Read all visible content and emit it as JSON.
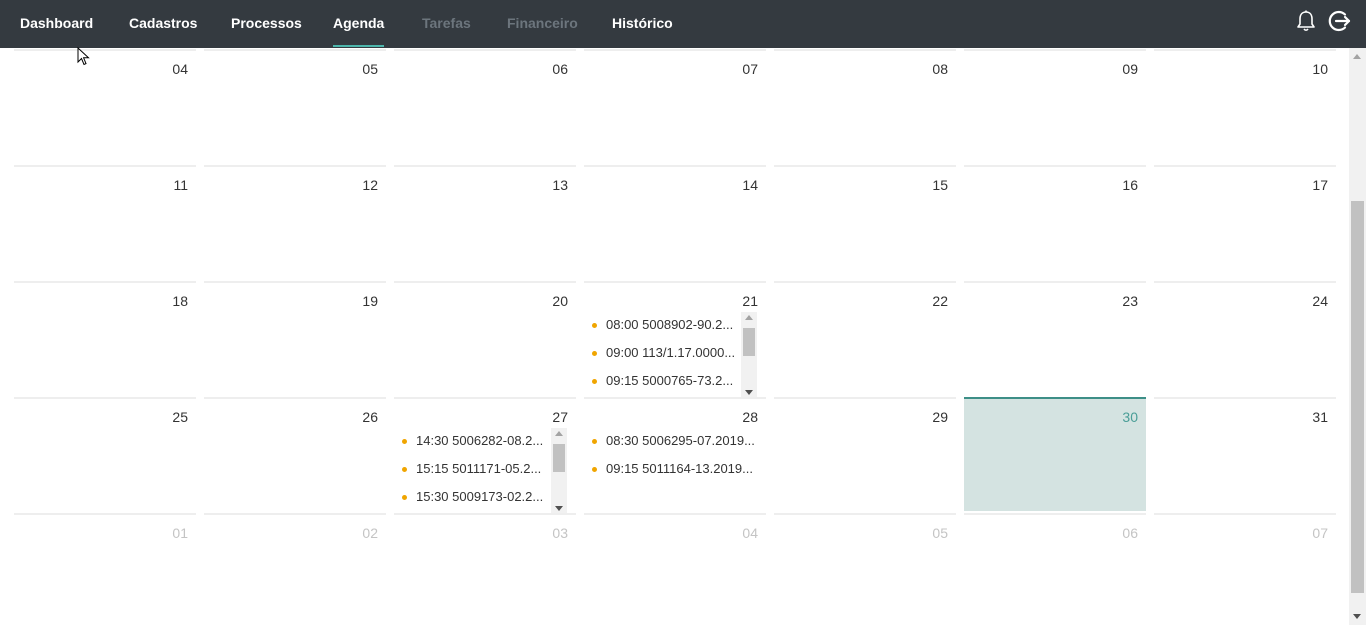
{
  "nav": {
    "items": [
      {
        "label": "Dashboard",
        "state": "normal"
      },
      {
        "label": "Cadastros",
        "state": "normal"
      },
      {
        "label": "Processos",
        "state": "normal"
      },
      {
        "label": "Agenda",
        "state": "active"
      },
      {
        "label": "Tarefas",
        "state": "disabled"
      },
      {
        "label": "Financeiro",
        "state": "disabled"
      },
      {
        "label": "Histórico",
        "state": "normal"
      }
    ],
    "right_icons": [
      "bell-icon",
      "logout-icon"
    ]
  },
  "colors": {
    "topbar": "#343a40",
    "active_underline": "#4db6ac",
    "today_bg": "#d4e3e1",
    "today_border": "#3d8f87",
    "event_dot": "#f0a500"
  },
  "calendar": {
    "weeks": [
      [
        {
          "day": "04"
        },
        {
          "day": "05"
        },
        {
          "day": "06"
        },
        {
          "day": "07"
        },
        {
          "day": "08"
        },
        {
          "day": "09"
        },
        {
          "day": "10"
        }
      ],
      [
        {
          "day": "11"
        },
        {
          "day": "12"
        },
        {
          "day": "13"
        },
        {
          "day": "14"
        },
        {
          "day": "15"
        },
        {
          "day": "16"
        },
        {
          "day": "17"
        }
      ],
      [
        {
          "day": "18"
        },
        {
          "day": "19"
        },
        {
          "day": "20"
        },
        {
          "day": "21",
          "events": [
            "08:00 5008902-90.2...",
            "09:00 113/1.17.0000...",
            "09:15 5000765-73.2..."
          ]
        },
        {
          "day": "22"
        },
        {
          "day": "23"
        },
        {
          "day": "24"
        }
      ],
      [
        {
          "day": "25"
        },
        {
          "day": "26"
        },
        {
          "day": "27",
          "events": [
            "14:30 5006282-08.2...",
            "15:15 5011171-05.2...",
            "15:30 5009173-02.2..."
          ]
        },
        {
          "day": "28",
          "events": [
            "08:30 5006295-07.2019...",
            "09:15 5011164-13.2019..."
          ]
        },
        {
          "day": "29"
        },
        {
          "day": "30",
          "today": true
        },
        {
          "day": "31"
        }
      ],
      [
        {
          "day": "01",
          "other": true
        },
        {
          "day": "02",
          "other": true
        },
        {
          "day": "03",
          "other": true
        },
        {
          "day": "04",
          "other": true
        },
        {
          "day": "05",
          "other": true
        },
        {
          "day": "06",
          "other": true
        },
        {
          "day": "07",
          "other": true
        }
      ]
    ]
  }
}
